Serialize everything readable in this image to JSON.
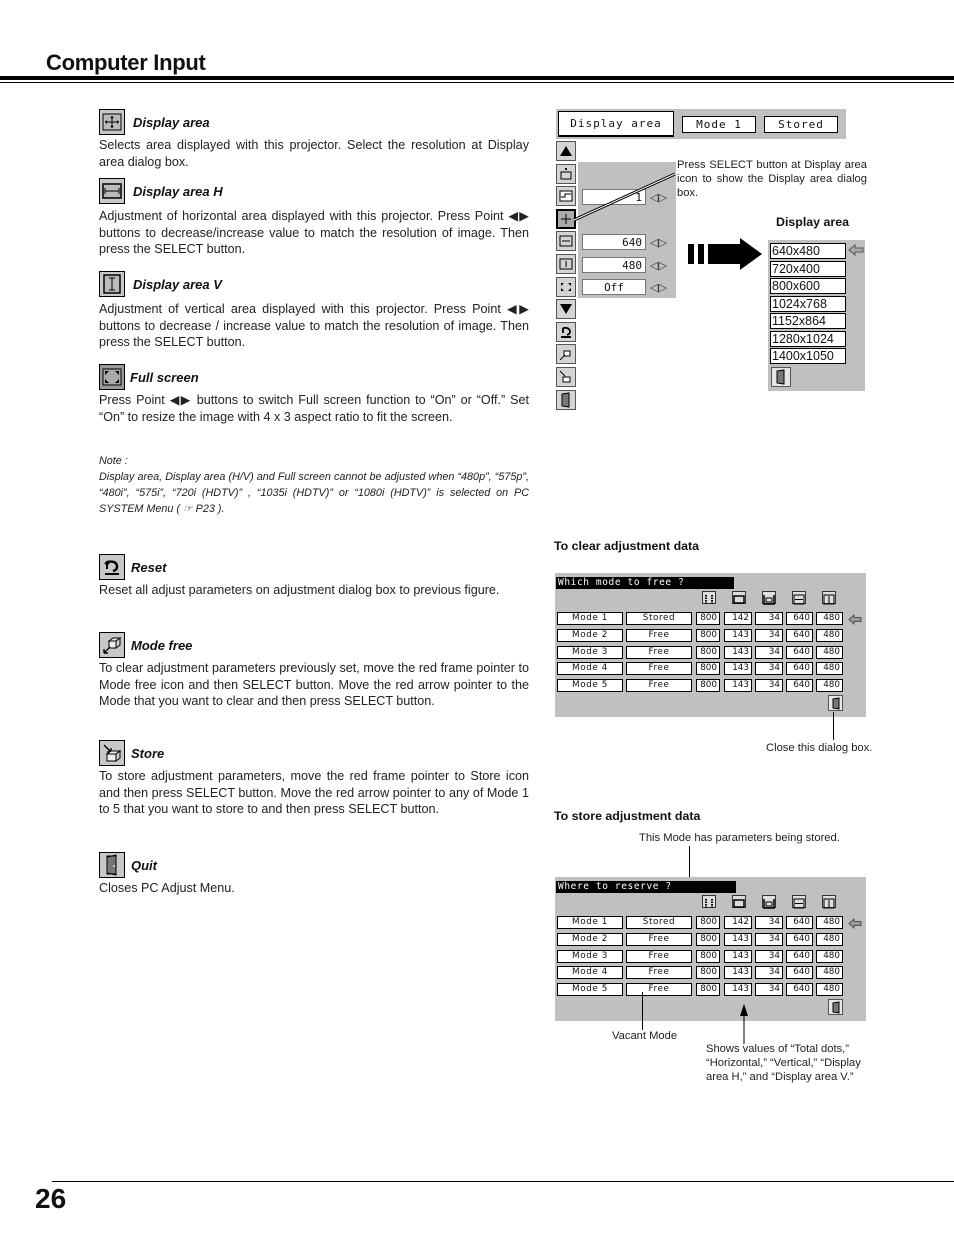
{
  "header": {
    "title": "Computer Input"
  },
  "sections": [
    {
      "icon": "display-area-icon",
      "title": "Display area",
      "text": "Selects area displayed with this projector.  Select the resolution at Display area dialog box."
    },
    {
      "icon": "display-area-h-icon",
      "title": "Display area H",
      "text": "Adjustment of horizontal area displayed with this projector.  Press Point ◀▶ buttons to decrease/increase value to match the resolution of image. Then press the SELECT button."
    },
    {
      "icon": "display-area-v-icon",
      "title": "Display area V",
      "text": "Adjustment of vertical area displayed with this projector.  Press Point ◀▶ buttons to decrease / increase value to match the resolution of image. Then press the SELECT button."
    },
    {
      "icon": "full-screen-icon",
      "title": "Full screen",
      "text": "Press Point ◀▶ buttons to switch Full screen function to  “On” or “Off.”  Set “On” to resize the image with 4 x 3 aspect ratio to fit the screen."
    },
    {
      "icon": "reset-icon",
      "title": "Reset",
      "text": "Reset all adjust parameters on adjustment dialog box to previous figure."
    },
    {
      "icon": "mode-free-icon",
      "title": "Mode free",
      "text": "To clear adjustment parameters previously set, move the red frame pointer to Mode free icon and then SELECT button.  Move the red arrow pointer to the Mode that you want to clear and then press SELECT button."
    },
    {
      "icon": "store-icon",
      "title": "Store",
      "text": "To store adjustment parameters, move the red frame pointer to Store icon and then press SELECT button.  Move the red arrow pointer to any of Mode 1 to 5 that you want to store to and then press SELECT button."
    },
    {
      "icon": "quit-icon",
      "title": "Quit",
      "text": "Closes PC Adjust Menu."
    }
  ],
  "note": {
    "label": "Note :",
    "text": "Display area, Display area (H/V) and Full screen cannot be adjusted when “480p”, “575p”, “480i”, “575i”, “720i (HDTV)” , “1035i (HDTV)” or “1080i (HDTV)” is selected on PC SYSTEM Menu    ( ☞ P23 )."
  },
  "menu": {
    "tab": "Display area",
    "mode": "Mode 1",
    "status": "Stored",
    "values": {
      "row1": "1",
      "display_h": "640",
      "display_v": "480",
      "full_screen": "Off"
    },
    "callout": "Press SELECT button at Display area icon to show the Display area dialog box."
  },
  "display_area_dialog": {
    "title": "Display area",
    "resolutions": [
      "640x480",
      "720x400",
      "800x600",
      "1024x768",
      "1152x864",
      "1280x1024",
      "1400x1050"
    ],
    "selected": "640x480"
  },
  "clear_section": {
    "heading": "To clear adjustment data",
    "dialog_title": "Which mode to free ?",
    "close_caption": "Close this dialog box."
  },
  "store_section": {
    "heading": "To store adjustment data",
    "dialog_title": "Where to reserve ?",
    "stored_caption": "This Mode has parameters being stored.",
    "vacant_caption": "Vacant Mode",
    "values_caption": "Shows values of “Total dots,” “Horizontal,” “Vertical,” “Display area H,” and “Display area V.”"
  },
  "mode_table": {
    "clear_rows": [
      [
        "Mode 1",
        "Stored",
        "800",
        "142",
        "34",
        "640",
        "480"
      ],
      [
        "Mode 2",
        "Free",
        "800",
        "143",
        "34",
        "640",
        "480"
      ],
      [
        "Mode 3",
        "Free",
        "800",
        "143",
        "34",
        "640",
        "480"
      ],
      [
        "Mode 4",
        "Free",
        "800",
        "143",
        "34",
        "640",
        "480"
      ],
      [
        "Mode 5",
        "Free",
        "800",
        "143",
        "34",
        "640",
        "480"
      ]
    ],
    "store_rows": [
      [
        "Mode 1",
        "Stored",
        "800",
        "142",
        "34",
        "640",
        "480"
      ],
      [
        "Mode 2",
        "Free",
        "800",
        "143",
        "34",
        "640",
        "480"
      ],
      [
        "Mode 3",
        "Free",
        "800",
        "143",
        "34",
        "640",
        "480"
      ],
      [
        "Mode 4",
        "Free",
        "800",
        "143",
        "34",
        "640",
        "480"
      ],
      [
        "Mode 5",
        "Free",
        "800",
        "143",
        "34",
        "640",
        "480"
      ]
    ]
  },
  "footer": {
    "page_number": "26"
  }
}
